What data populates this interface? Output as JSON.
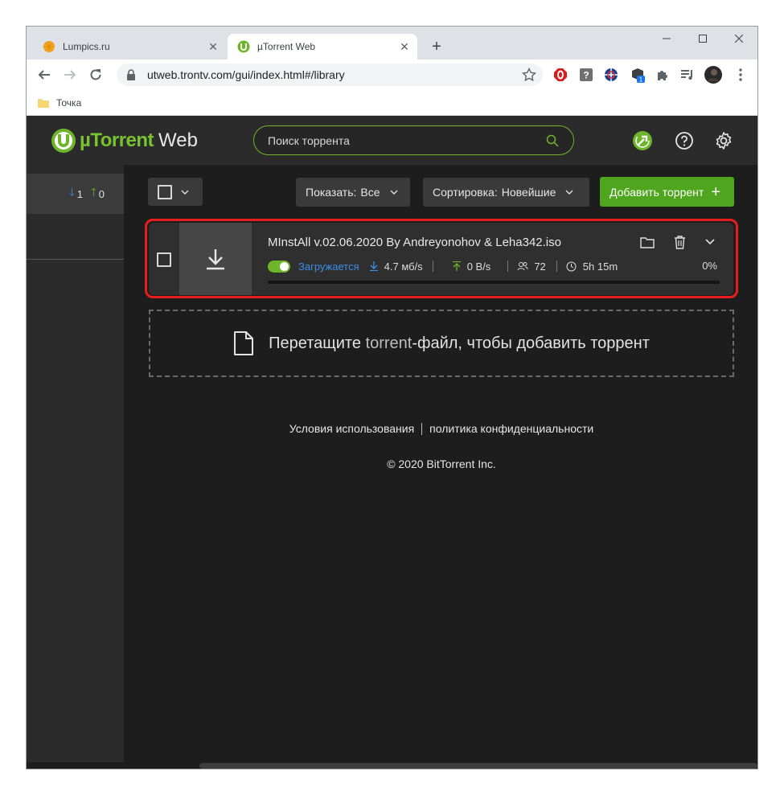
{
  "browser": {
    "tabs": [
      {
        "title": "Lumpics.ru",
        "active": false
      },
      {
        "title": "µTorrent Web",
        "active": true
      }
    ],
    "new_tab_symbol": "+",
    "close_symbol": "✕",
    "url": "utweb.trontv.com/gui/index.html#/library",
    "bookmarks": [
      {
        "label": "Точка"
      }
    ],
    "extensions": [
      "opera-adblock-icon",
      "help-ext-icon",
      "globe-ext-icon",
      "cube-ext-icon",
      "puzzle-icon",
      "playlist-icon",
      "avatar",
      "menu-icon"
    ],
    "extension_badge": "1"
  },
  "app": {
    "brand": "µTorrent",
    "brand_suffix": "Web",
    "search_placeholder": "Поиск торрента",
    "accent": "#6fb52b",
    "download_color": "#3d8ee8",
    "highlight_color": "#e81e1e"
  },
  "sidebar": {
    "download_count": "1",
    "upload_count": "0"
  },
  "toolbar": {
    "show_label": "Показать:",
    "show_value": "Все",
    "sort_label": "Сортировка:",
    "sort_value": "Новейшие",
    "add_label": "Добавить торрент",
    "add_symbol": "+"
  },
  "torrent": {
    "name": "MInstAll v.02.06.2020 By Andreyonohov & Leha342.iso",
    "status": "Загружается",
    "download_speed": "4.7 мб/s",
    "upload_speed": "0 B/s",
    "peers": "72",
    "eta": "5h 15m",
    "percent": "0%",
    "progress": 0.0
  },
  "dropzone": {
    "text_before": "Перетащите ",
    "text_highlight": "torrent",
    "text_after": "-файл, чтобы добавить торрент"
  },
  "footer": {
    "terms": "Условия использования",
    "privacy": "политика конфиденциальности",
    "copyright": "© 2020 BitTorrent Inc."
  }
}
